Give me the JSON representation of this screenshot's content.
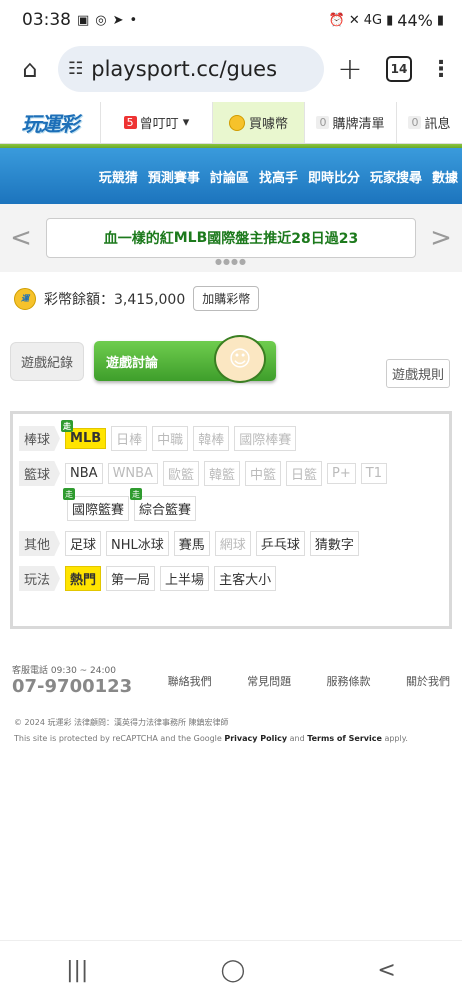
{
  "status": {
    "time": "03:38",
    "battery": "44%",
    "network": "4G"
  },
  "browser": {
    "url": "playsport.cc/gues",
    "tab_count": "14"
  },
  "site": {
    "logo": "玩運彩",
    "user": "曾叮叮",
    "user_badge": "5",
    "buy_coins": "買噱幣",
    "cart_badge": "0",
    "cart": "購牌清單",
    "msg_badge": "0",
    "msg": "訊息"
  },
  "nav": [
    "玩競猜",
    "預測賽事",
    "討論區",
    "找高手",
    "即時比分",
    "玩家搜尋",
    "數據"
  ],
  "ticker": {
    "text_pre": "血一樣的紅 ",
    "text_mlb": "MLB",
    "text_post": " 國際盤主推近28日過23"
  },
  "balance": {
    "label": "彩幣餘額：3,415,000",
    "add_button": "加購彩幣"
  },
  "tabs": {
    "record": "遊戲紀錄",
    "discuss": "遊戲討論",
    "rules": "遊戲規則"
  },
  "categories": {
    "baseball": {
      "label": "棒球",
      "items": [
        "MLB",
        "日棒",
        "中職",
        "韓棒",
        "國際棒賽"
      ]
    },
    "basketball": {
      "label": "籃球",
      "items": [
        "NBA",
        "WNBA",
        "歐籃",
        "韓籃",
        "中籃",
        "日籃",
        "P+",
        "T1"
      ],
      "items2": [
        "國際籃賽",
        "綜合籃賽"
      ]
    },
    "other": {
      "label": "其他",
      "items": [
        "足球",
        "NHL冰球",
        "賽馬",
        "網球",
        "乒乓球",
        "猜數字"
      ]
    },
    "play": {
      "label": "玩法",
      "items": [
        "熱門",
        "第一局",
        "上半場",
        "主客大小"
      ]
    }
  },
  "footer": {
    "hotline_label": "客服電話 09:30 ~ 24:00",
    "hotline": "07-9700123",
    "links": [
      "聯絡我們",
      "常見問題",
      "服務條款",
      "關於我們"
    ],
    "copyright": "© 2024 玩運彩 法律顧問：漢英得力法律事務所 陳鎮宏律師",
    "recaptcha_pre": "This site is protected by reCAPTCHA and the Google ",
    "privacy": "Privacy Policy",
    "and": " and ",
    "terms": "Terms of Service",
    "apply": " apply."
  }
}
